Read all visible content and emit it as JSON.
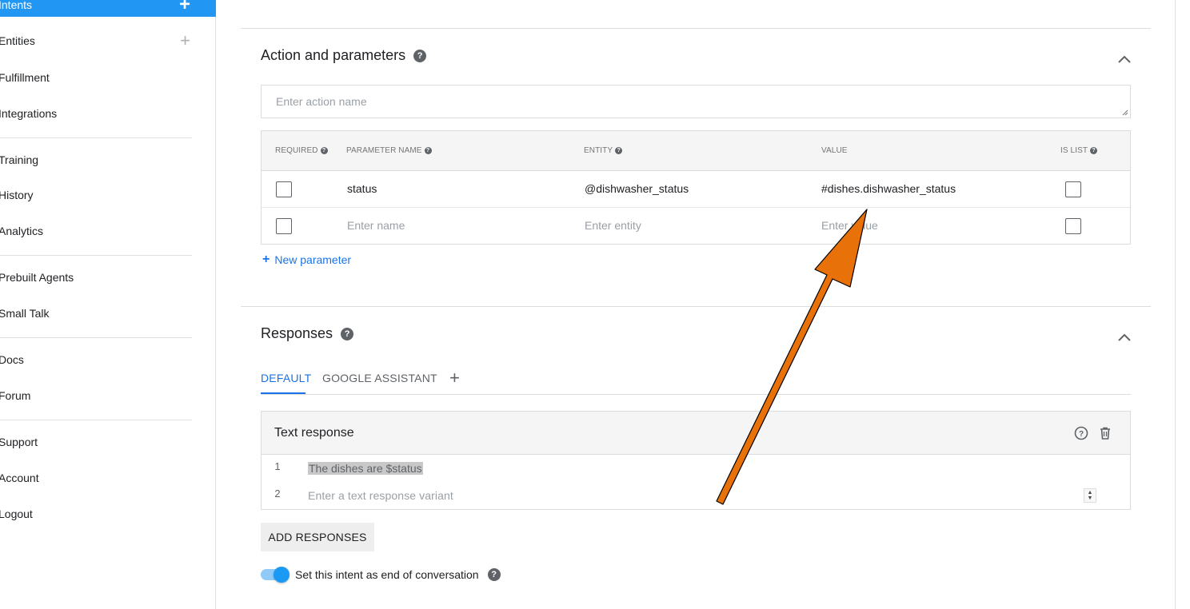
{
  "sidebar": {
    "items": [
      {
        "label": "Intents",
        "plus": "+"
      },
      {
        "label": "Entities",
        "plus": "+"
      },
      {
        "label": "Fulfillment"
      },
      {
        "label": "Integrations"
      },
      {
        "label": "Training"
      },
      {
        "label": "History"
      },
      {
        "label": "Analytics"
      },
      {
        "label": "Prebuilt Agents"
      },
      {
        "label": "Small Talk"
      },
      {
        "label": "Docs"
      },
      {
        "label": "Forum"
      },
      {
        "label": "Support"
      },
      {
        "label": "Account"
      },
      {
        "label": "Logout"
      }
    ]
  },
  "action": {
    "title": "Action and parameters",
    "placeholder": "Enter action name",
    "headers": {
      "required": "REQUIRED",
      "param_name": "PARAMETER NAME",
      "entity": "ENTITY",
      "value": "VALUE",
      "is_list": "IS LIST"
    },
    "rows": [
      {
        "name": "status",
        "entity": "@dishwasher_status",
        "value": "#dishes.dishwasher_status"
      },
      {
        "name": "Enter name",
        "entity": "Enter entity",
        "value": "Enter value"
      }
    ],
    "new_param": "New parameter"
  },
  "responses": {
    "title": "Responses",
    "tabs": [
      "DEFAULT",
      "GOOGLE ASSISTANT"
    ],
    "tab_add": "+",
    "card_title": "Text response",
    "lines": [
      {
        "num": "1",
        "text": "The dishes are $status"
      },
      {
        "num": "2",
        "text": "Enter a text response variant"
      }
    ],
    "add_button": "ADD RESPONSES",
    "end_toggle": "Set this intent as end of conversation",
    "end_toggle_on": true
  },
  "colors": {
    "accent": "#2196f3",
    "link": "#1a73e8",
    "annotation_arrow": "#e8710a"
  },
  "icons": {
    "help": "question-circle-icon",
    "collapse": "chevron-up-icon",
    "delete": "trash-icon"
  }
}
